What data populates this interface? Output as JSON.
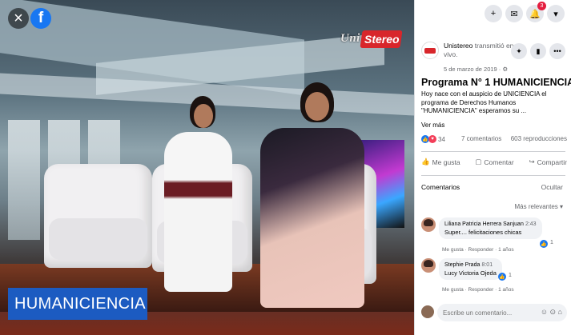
{
  "video": {
    "close_icon": "×",
    "fb_icon": "f",
    "logo_uni": "Uni",
    "logo_stereo": "Stereo",
    "caption": "HUMANICIENCIA"
  },
  "topbar": {
    "plus": "+",
    "messenger": "✉",
    "bell": "🔔",
    "bell_badge": "3",
    "menu": "▾"
  },
  "post": {
    "page_name": "Unistereo",
    "action_text": " transmitió en vivo.",
    "date": "5 de marzo de 2019 · ⚙",
    "title": "Programa N° 1 HUMANICIENCIA",
    "body": "Hoy nace con el auspicio de UNICIENCIA el programa de Derechos Humanos \"HUMANICIENCIA\" esperamos su ...",
    "see_more": "Ver más",
    "reaction_count": "34",
    "comments_count": "7 comentarios",
    "views": "603 reproducciones",
    "like_label": "Me gusta",
    "comment_label": "Comentar",
    "share_label": "Compartir"
  },
  "comments_section": {
    "header": "Comentarios",
    "hide": "Ocultar",
    "sort": "Más relevantes ▾",
    "items": [
      {
        "author": "Liliana Patricia Herrera Sanjuan",
        "time": "2:43",
        "text": "Super.... felicitaciones chicas",
        "likes": "1",
        "meta": "Me gusta · Responder · 1 años"
      },
      {
        "author": "Stephie Prada",
        "time": "8:01",
        "text": "Lucy Victoria Ojeda",
        "likes": "1",
        "meta": "Me gusta · Responder · 1 años"
      }
    ],
    "input_placeholder": "Escribe un comentario...",
    "input_icons": "☺ ⊙ ⌂"
  }
}
